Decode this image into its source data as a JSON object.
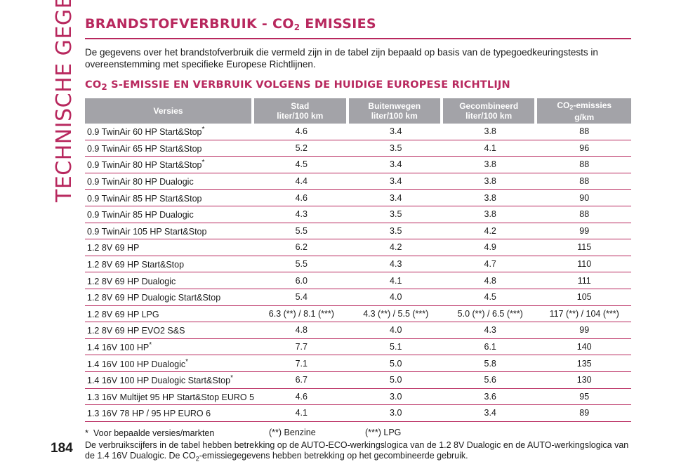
{
  "side_title": "TECHNISCHE GEGEVENS",
  "page_number": "184",
  "heading": {
    "pre": "BRANDSTOFVERBRUIK - CO",
    "sub": "2",
    "post": " EMISSIES"
  },
  "intro": "De gegevens over het brandstofverbruik die vermeld zijn in de tabel zijn bepaald op basis van de typegoedkeuringstests in overeenstemming met specifieke Europese Richtlijnen.",
  "subheading": {
    "pre": "CO",
    "sub": "2",
    "post": " S-EMISSIE EN VERBRUIK VOLGENS DE HUIDIGE EUROPESE RICHTLIJN"
  },
  "table": {
    "headers": {
      "versies": "Versies",
      "stad_1": "Stad",
      "stad_2": "liter/100 km",
      "buiten_1": "Buitenwegen",
      "buiten_2": "liter/100 km",
      "gecomb_1": "Gecombineerd",
      "gecomb_2": "liter/100 km",
      "co2_pre": "CO",
      "co2_sub": "2",
      "co2_post": "-emissies",
      "co2_2": "g/km"
    },
    "rows": [
      {
        "name": "0.9 TwinAir 60 HP Start&Stop",
        "mark": "*",
        "stad": "4.6",
        "buiten": "3.4",
        "gecomb": "3.8",
        "co2": "88"
      },
      {
        "name": "0.9 TwinAir 65 HP Start&Stop",
        "mark": "",
        "stad": "5.2",
        "buiten": "3.5",
        "gecomb": "4.1",
        "co2": "96"
      },
      {
        "name": "0.9 TwinAir 80 HP Start&Stop",
        "mark": "*",
        "stad": "4.5",
        "buiten": "3.4",
        "gecomb": "3.8",
        "co2": "88"
      },
      {
        "name": "0.9 TwinAir 80 HP Dualogic",
        "mark": "",
        "stad": "4.4",
        "buiten": "3.4",
        "gecomb": "3.8",
        "co2": "88"
      },
      {
        "name": "0.9 TwinAir 85 HP Start&Stop",
        "mark": "",
        "stad": "4.6",
        "buiten": "3.4",
        "gecomb": "3.8",
        "co2": "90"
      },
      {
        "name": "0.9 TwinAir 85 HP Dualogic",
        "mark": "",
        "stad": "4.3",
        "buiten": "3.5",
        "gecomb": "3.8",
        "co2": "88"
      },
      {
        "name": "0.9 TwinAir 105 HP Start&Stop",
        "mark": "",
        "stad": "5.5",
        "buiten": "3.5",
        "gecomb": "4.2",
        "co2": "99"
      },
      {
        "name": "1.2 8V 69 HP",
        "mark": "",
        "stad": "6.2",
        "buiten": "4.2",
        "gecomb": "4.9",
        "co2": "115"
      },
      {
        "name": "1.2 8V 69 HP Start&Stop",
        "mark": "",
        "stad": "5.5",
        "buiten": "4.3",
        "gecomb": "4.7",
        "co2": "110"
      },
      {
        "name": "1.2 8V 69 HP Dualogic",
        "mark": "",
        "stad": "6.0",
        "buiten": "4.1",
        "gecomb": "4.8",
        "co2": "111"
      },
      {
        "name": "1.2 8V 69 HP Dualogic Start&Stop",
        "mark": "",
        "stad": "5.4",
        "buiten": "4.0",
        "gecomb": "4.5",
        "co2": "105"
      },
      {
        "name": "1.2 8V 69 HP LPG",
        "mark": "",
        "stad": "6.3 (**) / 8.1 (***)",
        "buiten": "4.3 (**) / 5.5 (***)",
        "gecomb": "5.0 (**) / 6.5 (***)",
        "co2": "117 (**) / 104 (***)"
      },
      {
        "name": "1.2 8V 69 HP EVO2 S&S",
        "mark": "",
        "stad": "4.8",
        "buiten": "4.0",
        "gecomb": "4.3",
        "co2": "99"
      },
      {
        "name": "1.4 16V 100 HP",
        "mark": "*",
        "stad": "7.7",
        "buiten": "5.1",
        "gecomb": "6.1",
        "co2": "140"
      },
      {
        "name": "1.4 16V 100 HP Dualogic",
        "mark": "*",
        "stad": "7.1",
        "buiten": "5.0",
        "gecomb": "5.8",
        "co2": "135"
      },
      {
        "name": "1.4 16V 100 HP Dualogic Start&Stop",
        "mark": "*",
        "stad": "6.7",
        "buiten": "5.0",
        "gecomb": "5.6",
        "co2": "130"
      },
      {
        "name": "1.3 16V Multijet 95 HP Start&Stop EURO 5",
        "mark": "",
        "stad": "4.6",
        "buiten": "3.0",
        "gecomb": "3.6",
        "co2": "95"
      },
      {
        "name": "1.3 16V 78 HP / 95 HP EURO 6",
        "mark": "",
        "stad": "4.1",
        "buiten": "3.0",
        "gecomb": "3.4",
        "co2": "89"
      }
    ]
  },
  "notes": {
    "star_symbol": "*",
    "star_text": "Voor bepaalde versies/markten",
    "double_text": "(**)  Benzine",
    "triple_text": "(***)  LPG",
    "footer_pre": "De verbruikscijfers in de tabel hebben betrekking op de AUTO-ECO-werkingslogica van de 1.2 8V Dualogic en de AUTO-werkingslogica van de 1.4 16V Dualogic. De CO",
    "footer_sub": "2",
    "footer_post": "-emissiegegevens hebben betrekking op het gecombineerde gebruik."
  },
  "colors": {
    "accent": "#b8285e",
    "header_bg": "#a3a3a8"
  }
}
